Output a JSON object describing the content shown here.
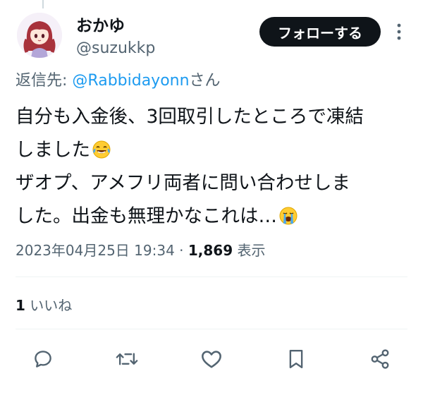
{
  "user": {
    "display_name": "おかゆ",
    "handle": "@suzukkp"
  },
  "header": {
    "follow_label": "フォローする"
  },
  "reply": {
    "prefix": "返信先: ",
    "mention": "@Rabbidayonn",
    "suffix": "さん"
  },
  "tweet": {
    "line1": "自分も入金後、3回取引したところで凍結",
    "line2": "しました",
    "line3": "ザオプ、アメフリ両者に問い合わせしま",
    "line4": "した。出金も無理かなこれは…"
  },
  "meta": {
    "timestamp": "2023年04月25日 19:34",
    "separator": " · ",
    "views_count": "1,869",
    "views_label": " 表示"
  },
  "stats": {
    "likes_count": "1",
    "likes_label": " いいね"
  },
  "icons": {
    "emoji_1": "face-with-tears-of-joy",
    "emoji_2": "loudly-crying-face",
    "actions": [
      "reply-icon",
      "retweet-icon",
      "like-icon",
      "bookmark-icon",
      "share-icon"
    ]
  }
}
